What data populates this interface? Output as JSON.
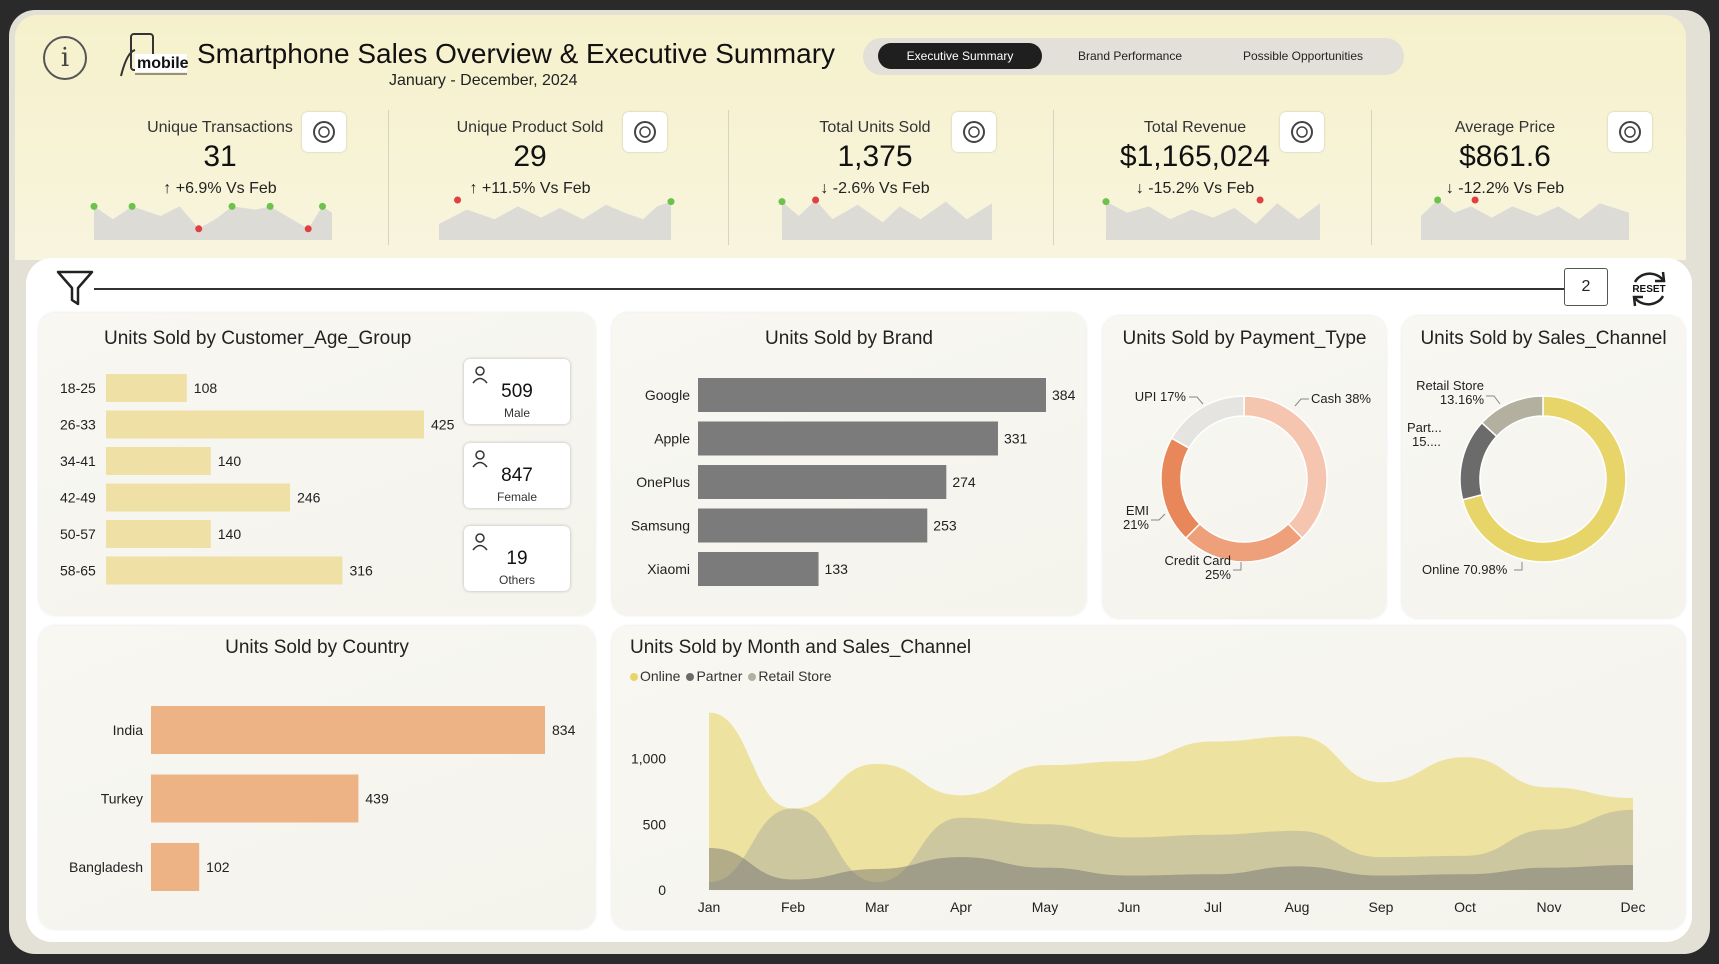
{
  "header": {
    "title": "Smartphone Sales Overview & Executive Summary",
    "subtitle": "January - December, 2024",
    "logo_text": "mobile",
    "info_icon": "info-icon",
    "tabs": [
      {
        "label": "Executive Summary",
        "active": true
      },
      {
        "label": "Brand Performance",
        "active": false
      },
      {
        "label": "Possible Opportunities",
        "active": false
      }
    ]
  },
  "kpis": [
    {
      "label": "Unique Transactions",
      "value": "31",
      "delta": "↑ +6.9% Vs Feb",
      "icon": "money-cycle-icon"
    },
    {
      "label": "Unique Product Sold",
      "value": "29",
      "delta": "↑ +11.5% Vs Feb",
      "icon": "smartphone-icon"
    },
    {
      "label": "Total Units Sold",
      "value": "1,375",
      "delta": "↓ -2.6% Vs Feb",
      "icon": "phones-stack-icon"
    },
    {
      "label": "Total Revenue",
      "value": "$1,165,024",
      "delta": "↓ -15.2% Vs Feb",
      "icon": "dollar-cycle-icon"
    },
    {
      "label": "Average Price",
      "value": "$861.6",
      "delta": "↓ -12.2% Vs Feb",
      "icon": "dollar-refresh-icon"
    }
  ],
  "filter_bar": {
    "page_number": "2",
    "reset_label": "RESET"
  },
  "colors": {
    "age_bar": "#efe0a6",
    "brand_bar": "#7b7b7b",
    "country_bar": "#edb384",
    "online": "#e8d56a",
    "partner": "#6b6b6b",
    "retail": "#b3b0a0",
    "cash": "#f5c5b0",
    "credit": "#eda07a",
    "emi": "#e8885a",
    "upi": "#e6e4e0",
    "spark_up": "#6cc24a",
    "spark_down": "#e04040"
  },
  "age_chart": {
    "title": "Units Sold by Customer_Age_Group",
    "chart_data": {
      "type": "bar",
      "categories": [
        "18-25",
        "26-33",
        "34-41",
        "42-49",
        "50-57",
        "58-65"
      ],
      "values": [
        108,
        425,
        140,
        246,
        140,
        316
      ]
    }
  },
  "gender": [
    {
      "value": "509",
      "label": "Male",
      "icon": "male-user-icon"
    },
    {
      "value": "847",
      "label": "Female",
      "icon": "female-user-icon"
    },
    {
      "value": "19",
      "label": "Others",
      "icon": "gender-symbols-icon"
    }
  ],
  "brand_chart": {
    "title": "Units Sold by Brand",
    "chart_data": {
      "type": "bar",
      "categories": [
        "Google",
        "Apple",
        "OnePlus",
        "Samsung",
        "Xiaomi"
      ],
      "values": [
        384,
        331,
        274,
        253,
        133
      ]
    }
  },
  "payment_chart": {
    "title": "Units Sold by Payment_Type",
    "chart_data": {
      "type": "pie",
      "categories": [
        "Cash",
        "Credit Card",
        "EMI",
        "UPI"
      ],
      "values": [
        38,
        25,
        21,
        17
      ],
      "labels": [
        "Cash 38%",
        "Credit Card",
        "25%",
        "EMI",
        "21%",
        "UPI 17%"
      ]
    }
  },
  "channel_chart": {
    "title": "Units Sold by Sales_Channel",
    "chart_data": {
      "type": "pie",
      "categories": [
        "Online",
        "Partner",
        "Retail Store"
      ],
      "values": [
        70.98,
        15.86,
        13.16
      ],
      "labels": [
        "Retail Store",
        "13.16%",
        "Part...",
        "15....",
        "Online 70.98%"
      ]
    }
  },
  "country_chart": {
    "title": "Units Sold by Country",
    "chart_data": {
      "type": "bar",
      "categories": [
        "India",
        "Turkey",
        "Bangladesh"
      ],
      "values": [
        834,
        439,
        102
      ]
    }
  },
  "month_chart": {
    "title": "Units Sold by Month and Sales_Channel",
    "chart_data": {
      "type": "area",
      "categories": [
        "Jan",
        "Feb",
        "Mar",
        "Apr",
        "May",
        "Jun",
        "Jul",
        "Aug",
        "Sep",
        "Oct",
        "Nov",
        "Dec"
      ],
      "series": [
        {
          "name": "Online",
          "values": [
            1350,
            620,
            960,
            720,
            950,
            980,
            1130,
            1170,
            820,
            1010,
            780,
            700
          ]
        },
        {
          "name": "Partner",
          "values": [
            320,
            80,
            160,
            250,
            170,
            110,
            120,
            180,
            110,
            120,
            170,
            190
          ]
        },
        {
          "name": "Retail Store",
          "values": [
            60,
            620,
            60,
            550,
            500,
            400,
            420,
            450,
            250,
            260,
            460,
            610
          ]
        }
      ],
      "y_ticks": [
        "0",
        "500",
        "1,000"
      ],
      "ylim": [
        0,
        1400
      ]
    },
    "legend": [
      "Online",
      "Partner",
      "Retail Store"
    ]
  }
}
